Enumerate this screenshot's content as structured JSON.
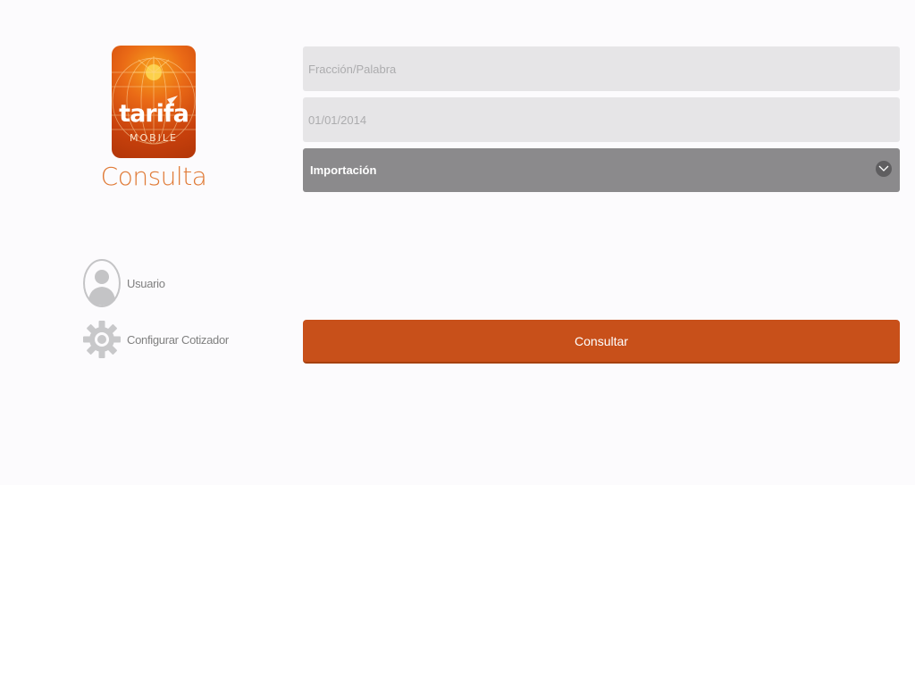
{
  "brand": {
    "logo_word": "tarifa",
    "logo_sub": "MOBILE",
    "title": "Consulta",
    "accent_color": "#c8501a"
  },
  "sidebar": {
    "items": [
      {
        "label": "Usuario",
        "icon": "user-avatar-icon"
      },
      {
        "label": "Configurar Cotizador",
        "icon": "gear-icon"
      }
    ]
  },
  "form": {
    "fraccion_placeholder": "Fracción/Palabra",
    "fecha_placeholder": "01/01/2014",
    "operation_selected": "Importación",
    "submit_label": "Consultar"
  }
}
